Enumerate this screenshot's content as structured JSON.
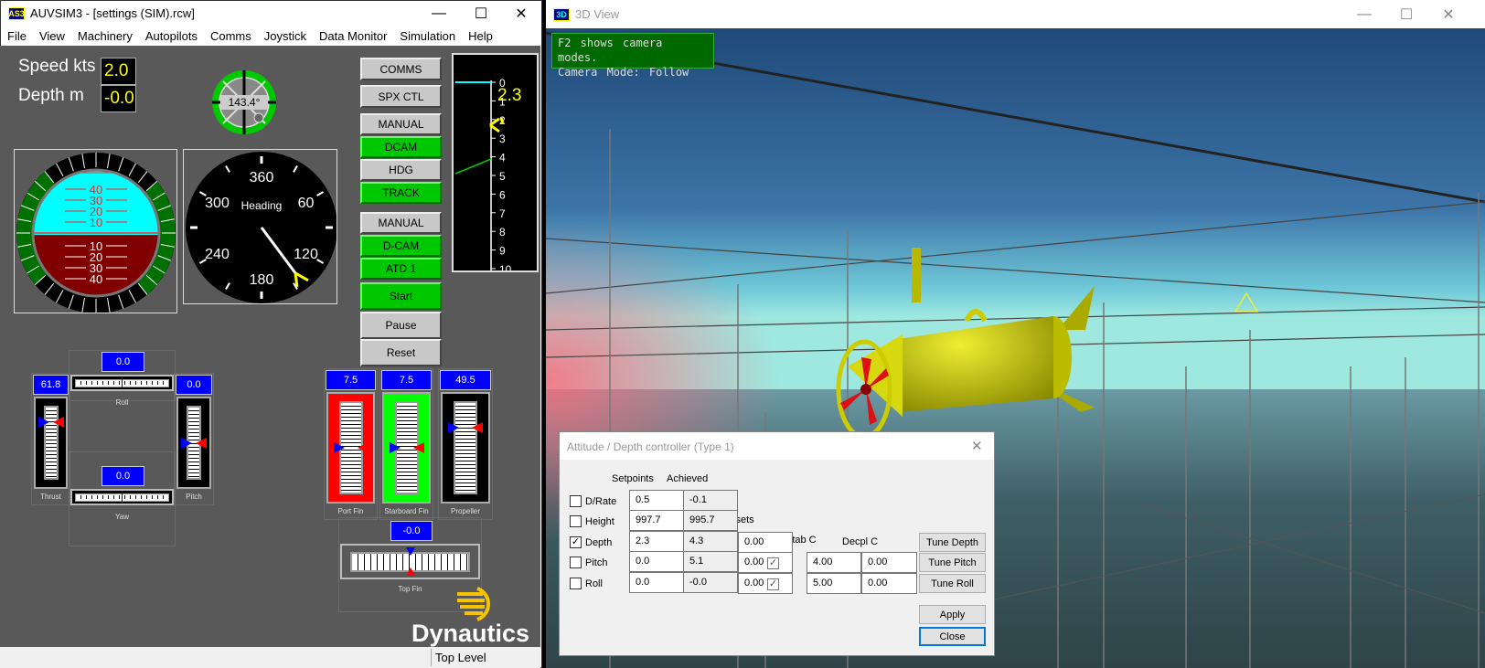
{
  "main_window": {
    "title": "AUVSIM3 - [settings (SIM).rcw]",
    "icon_text": "AS3",
    "menu": [
      "File",
      "View",
      "Machinery",
      "Autopilots",
      "Comms",
      "Joystick",
      "Data Monitor",
      "Simulation",
      "Help"
    ],
    "speed_label": "Speed kts",
    "speed_value": "2.0",
    "depth_label": "Depth m",
    "depth_value": "-0.0",
    "compass_readout": "143.4°",
    "buttons": [
      {
        "label": "COMMS",
        "state": "grey"
      },
      {
        "label": "SPX CTL",
        "state": "grey"
      },
      {
        "label": "MANUAL",
        "state": "grey"
      },
      {
        "label": "DCAM",
        "state": "green"
      },
      {
        "label": "HDG",
        "state": "grey"
      },
      {
        "label": "TRACK",
        "state": "green"
      },
      {
        "label": "MANUAL",
        "state": "grey"
      },
      {
        "label": "D-CAM",
        "state": "green"
      },
      {
        "label": "ATD 1",
        "state": "green"
      },
      {
        "label": "Start",
        "state": "green"
      },
      {
        "label": "Pause",
        "state": "grey"
      },
      {
        "label": "Reset",
        "state": "grey"
      }
    ],
    "attitude": {
      "pitch_ticks": [
        "40",
        "30",
        "20",
        "10",
        "10",
        "20",
        "30",
        "40"
      ]
    },
    "heading": {
      "title": "Heading",
      "labels": [
        "360",
        "60",
        "120",
        "180",
        "240",
        "300"
      ],
      "value_deg": 143.4
    },
    "depth_gauge": {
      "ticks": [
        "0",
        "1",
        "2",
        "3",
        "4",
        "5",
        "6",
        "7",
        "8",
        "9",
        "10"
      ],
      "readout": "2.3"
    },
    "joystick": {
      "roll": {
        "label": "Roll",
        "value": "0.0",
        "level": 0.5
      },
      "yaw": {
        "label": "Yaw",
        "value": "0.0",
        "level": 0.5
      },
      "thrust": {
        "label": "Thrust",
        "value": "61.8",
        "level": 0.78
      },
      "pitch": {
        "label": "Pitch",
        "value": "0.0",
        "level": 0.5
      }
    },
    "actuators": {
      "port_fin": {
        "label": "Port Fin",
        "value": "7.5",
        "color": "#ff0000",
        "level": 0.5
      },
      "starboard_fin": {
        "label": "Starboard Fin",
        "value": "7.5",
        "color": "#00ff00",
        "level": 0.5
      },
      "propeller": {
        "label": "Propeller",
        "value": "49.5",
        "color": "#000000",
        "level": 0.72
      },
      "top_fin": {
        "label": "Top Fin",
        "value": "-0.0",
        "color": "#ffff00",
        "level": 0.5
      }
    },
    "logo": "Dynautics",
    "status": "Top Level"
  },
  "view3d": {
    "title": "3D View",
    "icon_text": "3D",
    "overlay_line1": "F2 shows camera modes.",
    "overlay_line2": "Camera Mode: Follow"
  },
  "dialog": {
    "title": "Attitude / Depth controller (Type 1)",
    "col_setpoints": "Setpoints",
    "col_achieved": "Achieved",
    "col_offsets": "Offsets",
    "col_stab": "Stab C",
    "col_decpl": "Decpl C",
    "rows": [
      {
        "label": "D/Rate",
        "checked": false,
        "setpoint": "0.5",
        "achieved": "-0.1"
      },
      {
        "label": "Height",
        "checked": false,
        "setpoint": "997.7",
        "achieved": "995.7"
      },
      {
        "label": "Depth",
        "checked": true,
        "setpoint": "2.3",
        "achieved": "4.3",
        "offset": "0.00"
      },
      {
        "label": "Pitch",
        "checked": false,
        "setpoint": "0.0",
        "achieved": "5.1",
        "offset": "0.00",
        "stab_checked": true,
        "stab": "4.00",
        "decpl": "0.00"
      },
      {
        "label": "Roll",
        "checked": false,
        "setpoint": "0.0",
        "achieved": "-0.0",
        "offset": "0.00",
        "stab_checked": true,
        "stab": "5.00",
        "decpl": "0.00"
      }
    ],
    "tune_depth": "Tune Depth",
    "tune_pitch": "Tune Pitch",
    "tune_roll": "Tune Roll",
    "apply": "Apply",
    "close": "Close"
  }
}
